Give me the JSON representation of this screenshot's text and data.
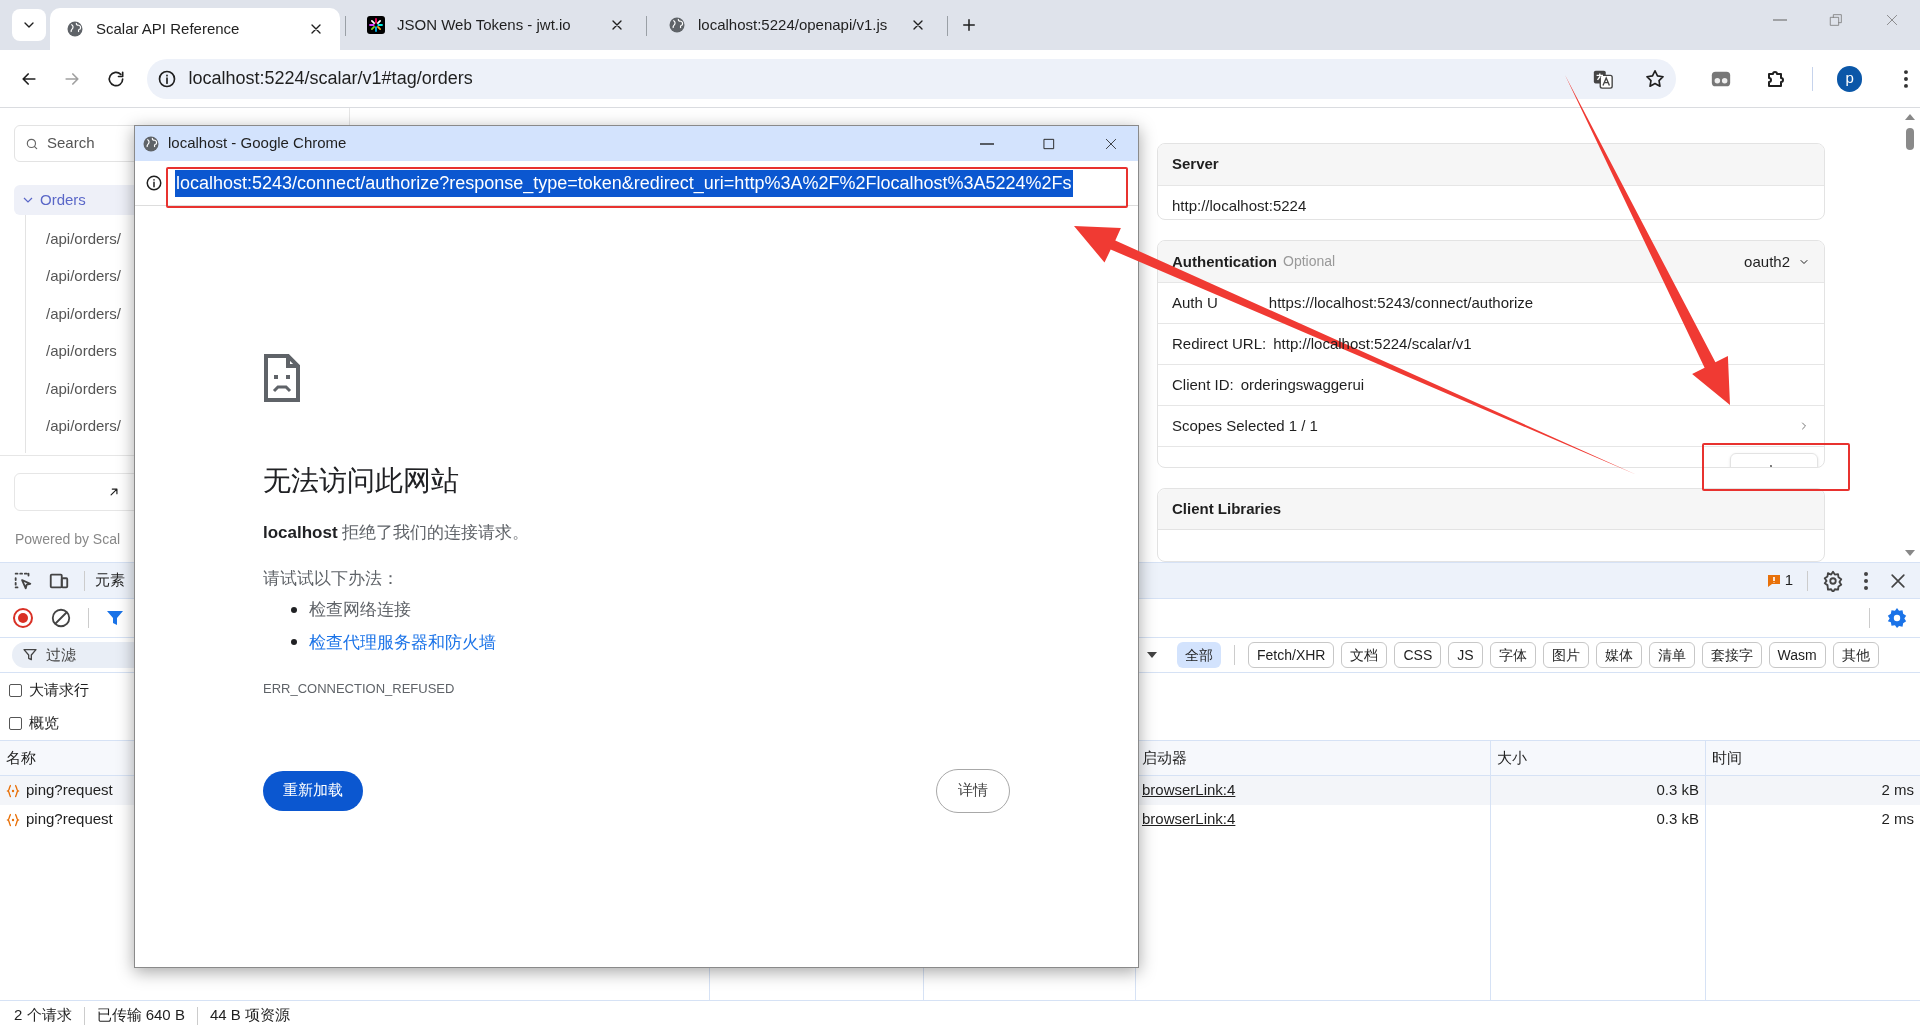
{
  "browser": {
    "tabs": [
      {
        "title": "Scalar API Reference",
        "selected": true
      },
      {
        "title": "JSON Web Tokens - jwt.io",
        "selected": false
      },
      {
        "title": "localhost:5224/openapi/v1.js",
        "selected": false
      }
    ],
    "address": "localhost:5224/scalar/v1#tag/orders",
    "profile_initial": "p"
  },
  "sidebar": {
    "search_placeholder": "Search",
    "group": {
      "label": "Orders",
      "expanded": true,
      "children": [
        {
          "label": "/api/orders/"
        },
        {
          "label": "/api/orders/"
        },
        {
          "label": "/api/orders/"
        },
        {
          "label": "/api/orders"
        },
        {
          "label": "/api/orders"
        },
        {
          "label": "/api/orders/"
        }
      ]
    },
    "powered_by": "Powered by Scal"
  },
  "auth_panel": {
    "server": {
      "title": "Server",
      "url": "http://localhost:5224"
    },
    "authentication": {
      "title": "Authentication",
      "badge": "Optional",
      "scheme": "oauth2",
      "fields": [
        {
          "label": "Auth U",
          "value": "https://localhost:5243/connect/authorize"
        },
        {
          "label": "Redirect URL:",
          "value": "http://localhost:5224/scalar/v1"
        },
        {
          "label": "Client ID:",
          "value": "orderingswaggerui"
        }
      ],
      "scopes": "Scopes Selected 1 / 1"
    },
    "client_libraries": {
      "title": "Client Libraries"
    }
  },
  "devtools": {
    "first_tab": "元素",
    "issues_count": "1",
    "filter_placeholder": "过滤",
    "type_filters": [
      {
        "label": "全部",
        "selected": true
      },
      {
        "label": "Fetch/XHR",
        "selected": false
      },
      {
        "label": "文档",
        "selected": false
      },
      {
        "label": "CSS",
        "selected": false
      },
      {
        "label": "JS",
        "selected": false
      },
      {
        "label": "字体",
        "selected": false
      },
      {
        "label": "图片",
        "selected": false
      },
      {
        "label": "媒体",
        "selected": false
      },
      {
        "label": "清单",
        "selected": false
      },
      {
        "label": "套接字",
        "selected": false
      },
      {
        "label": "Wasm",
        "selected": false
      },
      {
        "label": "其他",
        "selected": false
      }
    ],
    "options": [
      {
        "label": "大请求行",
        "checked": false
      },
      {
        "label": "概览",
        "checked": false
      }
    ],
    "columns": [
      {
        "label": "名称"
      },
      {
        "label": "启动器"
      },
      {
        "label": "大小"
      },
      {
        "label": "时间"
      }
    ],
    "rows": [
      {
        "name": "ping?request",
        "initiator": "browserLink:4",
        "size": "0.3 kB",
        "time": "2 ms"
      },
      {
        "name": "ping?request",
        "initiator": "browserLink:4",
        "size": "0.3 kB",
        "time": "2 ms"
      }
    ],
    "status": [
      "2 个请求",
      "已传输 640 B",
      "44 B 项资源"
    ]
  },
  "popup": {
    "title": "localhost - Google Chrome",
    "url": {
      "text": "localhost:5243/connect/authorize?response_type=token&redirect_uri=http%3A%2F%2Flocalhost%3A5224%2Fs",
      "selected": true
    },
    "heading": "无法访问此网站",
    "message": "**localhost** 拒绝了我们的连接请求。",
    "suggestions_title": "请试试以下办法：",
    "suggestions": [
      {
        "text": "检查网络连接",
        "link": false
      },
      {
        "text": "检查代理服务器和防火墙",
        "link": true
      }
    ],
    "error_code": "ERR_CONNECTION_REFUSED",
    "reload_button": "重新加载",
    "details_button": "详情"
  }
}
